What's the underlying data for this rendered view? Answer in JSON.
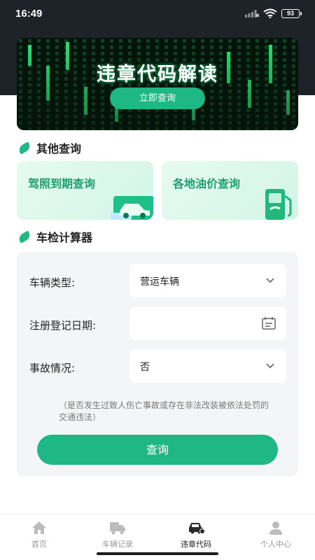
{
  "status_bar": {
    "time": "16:49",
    "battery": "93"
  },
  "banner": {
    "title": "违章代码解读",
    "button_label": "立即查询"
  },
  "other_section": {
    "title": "其他查询"
  },
  "cards": [
    {
      "label": "驾照到期查询"
    },
    {
      "label": "各地油价查询"
    }
  ],
  "calc_section": {
    "title": "车检计算器"
  },
  "form": {
    "vehicle_type": {
      "label": "车辆类型:",
      "value": "营运车辆"
    },
    "register_date": {
      "label": "注册登记日期:",
      "value": ""
    },
    "accident": {
      "label": "事故情况:",
      "value": "否"
    },
    "note": "（是否发生过致人伤亡事故或存在非法改装被依法处罚的交通违法）",
    "submit_label": "查询"
  },
  "tabs": [
    {
      "label": "首页",
      "icon": "home-icon",
      "active": false
    },
    {
      "label": "车辆记录",
      "icon": "truck-icon",
      "active": false
    },
    {
      "label": "违章代码",
      "icon": "car-icon",
      "active": true
    },
    {
      "label": "个人中心",
      "icon": "person-icon",
      "active": false
    }
  ],
  "colors": {
    "accent": "#1fb784",
    "dark_header": "#1e232a",
    "card_text": "#1d9e70"
  }
}
